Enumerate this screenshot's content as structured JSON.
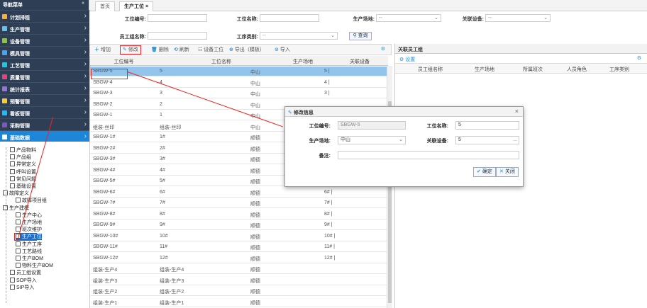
{
  "sidebar": {
    "title": "导航菜单",
    "collapse_glyph": "«",
    "menus": [
      {
        "label": "计划排程",
        "color": "#f0b04a"
      },
      {
        "label": "生产管理",
        "color": "#66c1f0"
      },
      {
        "label": "设备管理",
        "color": "#8bc34a"
      },
      {
        "label": "模具管理",
        "color": "#42a5f5"
      },
      {
        "label": "工艺管理",
        "color": "#26c6da"
      },
      {
        "label": "质量管理",
        "color": "#ec407a"
      },
      {
        "label": "统计报表",
        "color": "#9575cd"
      },
      {
        "label": "预警管理",
        "color": "#ffca28"
      },
      {
        "label": "看板管理",
        "color": "#29b6f6"
      },
      {
        "label": "采购管理",
        "color": "#7e57c2"
      },
      {
        "label": "基础数据",
        "color": "#ffffff"
      }
    ],
    "tree": [
      {
        "label": "产品物料",
        "indent": 1
      },
      {
        "label": "产品组",
        "indent": 1
      },
      {
        "label": "异常定义",
        "indent": 1
      },
      {
        "label": "呼叫设置",
        "indent": 1
      },
      {
        "label": "常见问题",
        "indent": 1
      },
      {
        "label": "基础设置",
        "indent": 1
      },
      {
        "label": "故障定义",
        "indent": 0
      },
      {
        "label": "故障项目组",
        "indent": 2
      },
      {
        "label": "生产建模",
        "indent": 0
      },
      {
        "label": "生产中心",
        "indent": 2
      },
      {
        "label": "生产场地",
        "indent": 2
      },
      {
        "label": "班次维护",
        "indent": 2
      },
      {
        "label": "生产工位",
        "indent": 2
      },
      {
        "label": "生产工序",
        "indent": 2
      },
      {
        "label": "工艺路线",
        "indent": 2
      },
      {
        "label": "生产BOM",
        "indent": 2
      },
      {
        "label": "物料生产BOM",
        "indent": 2
      },
      {
        "label": "员工组设置",
        "indent": 1
      },
      {
        "label": "SOP导入",
        "indent": 1
      },
      {
        "label": "SIP导入",
        "indent": 1
      }
    ]
  },
  "tabs": {
    "home": "首页",
    "current": "生产工位",
    "close": "×"
  },
  "filters": {
    "station_no_label": "工位编号:",
    "station_name_label": "工位名称:",
    "site_label": "生产场地:",
    "site_value": "--",
    "device_label": "关联设备:",
    "device_value": "--",
    "staff_label": "员工组名称:",
    "process_label": "工序类别:",
    "process_value": "--",
    "query_label": "查询"
  },
  "toolbar": {
    "add": "增加",
    "edit": "修改",
    "delete": "删除",
    "refresh": "刷新",
    "device_station": "设备工位",
    "export": "导出（模板）",
    "import": "导入"
  },
  "grid": {
    "headers": [
      "工位编号",
      "工位名称",
      "生产场地",
      "关联设备"
    ],
    "rows": [
      [
        "SBGW-5",
        "5",
        "中山",
        "5 |"
      ],
      [
        "SBGW-4",
        "4",
        "中山",
        "4 |"
      ],
      [
        "SBGW-3",
        "3",
        "中山",
        "3 |"
      ],
      [
        "SBGW-2",
        "2",
        "中山",
        ""
      ],
      [
        "SBGW-1",
        "1",
        "中山",
        ""
      ],
      [
        "组装-丝印",
        "组装-丝印",
        "中山",
        ""
      ],
      [
        "SBGW-1#",
        "1#",
        "顺德",
        ""
      ],
      [
        "SBGW-2#",
        "2#",
        "顺德",
        ""
      ],
      [
        "SBGW-3#",
        "3#",
        "顺德",
        ""
      ],
      [
        "SBGW-4#",
        "4#",
        "顺德",
        ""
      ],
      [
        "SBGW-5#",
        "5#",
        "顺德",
        ""
      ],
      [
        "SBGW-6#",
        "6#",
        "顺德",
        "6# |"
      ],
      [
        "SBGW-7#",
        "7#",
        "顺德",
        "7# |"
      ],
      [
        "SBGW-8#",
        "8#",
        "顺德",
        "8# |"
      ],
      [
        "SBGW-9#",
        "9#",
        "顺德",
        "9# |"
      ],
      [
        "SBGW-10#",
        "10#",
        "顺德",
        "10# |"
      ],
      [
        "SBGW-11#",
        "11#",
        "顺德",
        "11# |"
      ],
      [
        "SBGW-12#",
        "12#",
        "顺德",
        "12# |"
      ],
      [
        "组装-生产4",
        "组装-生产4",
        "顺德",
        ""
      ],
      [
        "组装-生产3",
        "组装-生产3",
        "顺德",
        ""
      ],
      [
        "组装-生产2",
        "组装-生产2",
        "顺德",
        ""
      ],
      [
        "组装-生产1",
        "组装-生产1",
        "顺德",
        ""
      ]
    ]
  },
  "right_panel": {
    "title": "关联员工组",
    "settings": "设置",
    "headers": [
      "员工组名称",
      "生产场地",
      "所属班次",
      "人员角色",
      "工序类别"
    ]
  },
  "modal": {
    "title": "修改信息",
    "close": "×",
    "station_no_label": "工位编号:",
    "station_no_value": "SBGW-5",
    "station_name_label": "工位名称:",
    "station_name_value": "5",
    "site_label": "生产场地:",
    "site_value": "中山",
    "device_label": "关联设备:",
    "device_value": "5",
    "device_more": "...",
    "remark_label": "备注:",
    "ok_label": "确定",
    "close_label": "关闭"
  },
  "colors": {
    "sidebar_bg": "#2e3f55",
    "active_menu": "#1e86d8",
    "selected_row": "#93c5ec",
    "annotation": "#e22222"
  }
}
